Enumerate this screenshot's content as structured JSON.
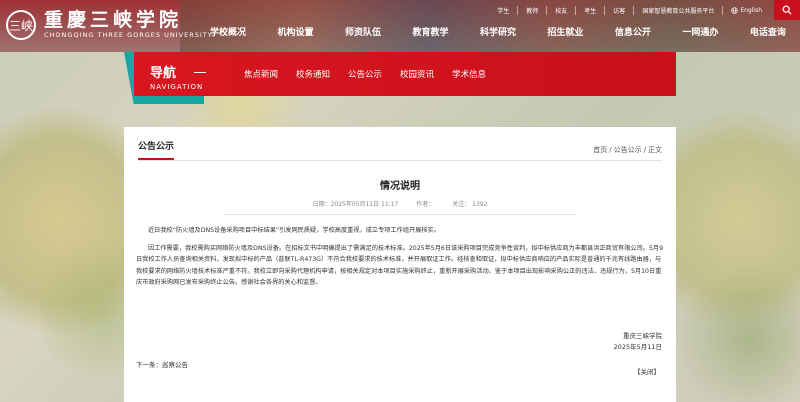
{
  "header": {
    "logo_mark": "三峡",
    "school_name_cn": "重慶三峡学院",
    "school_name_en": "CHONGQING THREE GORGES UNIVERSITY",
    "topbar": [
      "学生",
      "教师",
      "校友",
      "考生",
      "访客",
      "国家智慧教育公共服务平台",
      "English"
    ],
    "nav": [
      "学校概况",
      "机构设置",
      "师资队伍",
      "教育教学",
      "科学研究",
      "招生就业",
      "信息公开",
      "一网通办",
      "电话查询"
    ]
  },
  "subnav": {
    "title_cn": "导航",
    "title_en": "NAVIGATION",
    "links": [
      "焦点新闻",
      "校务通知",
      "公告公示",
      "校园资讯",
      "学术信息"
    ]
  },
  "card": {
    "section_title": "公告公示",
    "breadcrumb": [
      "首页",
      "公告公示",
      "正文"
    ],
    "breadcrumb_sep": "/",
    "article_title": "情况说明",
    "meta": {
      "date": "日期：2025年05月11日 11:17",
      "author": "作者：",
      "views_label": "关注：",
      "views": "1392"
    },
    "paragraphs": [
      "近日我校“防火墙及DNS设备采购项目中标结果”引发网民质疑，学校高度重视，成立专项工作组开展核实。",
      "因工作需要，我校需购买网络防火墙及DNS设备。在招标文书中明确提出了需满足的技术标准。2025年5月6日该采购项目完成竞争性谈判，拟中标供应商为丰都县洪正商贸有限公司。5月9日我校工作人员查询相关资料，发现拟中标的产品（普联TL-R473G）不符合我校要求的技术标准，并开展取证工作。经核查和取证，拟中标供应商响应的产品实际是普通的千兆有线路由器，与我校要求的网络防火墙技术标准严重不符。我校立即向采购代理机构申请，按相关规定对本项目实施采购终止，重新开展采购活动。鉴于本项目出现影响采购公正的违法、违规行为，5月10日重庆市政府采购网已发布采购终止公告。感谢社会各界的关心和监督。"
    ],
    "signature_org": "重庆三峡学院",
    "signature_date": "2025年5月11日",
    "prev": "下一条：巡察公告",
    "close": "【关闭】"
  },
  "colors": {
    "brand_red": "#c8101e",
    "accent_teal": "#1aa6a3"
  },
  "icons": {
    "search": "search-icon",
    "globe": "globe-icon",
    "logo": "university-seal-icon"
  }
}
